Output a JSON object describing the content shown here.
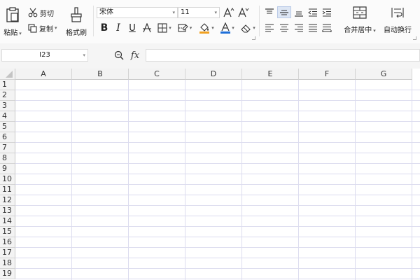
{
  "clipboard": {
    "paste": "粘贴",
    "cut": "剪切",
    "copy": "复制",
    "format_painter": "格式刷"
  },
  "font": {
    "name": "宋体",
    "size": "11"
  },
  "alignment": {
    "merge_center": "合并居中",
    "wrap_text": "自动换行"
  },
  "formula_bar": {
    "name_box": "I23",
    "fx_label": "fx",
    "value": ""
  },
  "columns": [
    "A",
    "B",
    "C",
    "D",
    "E",
    "F",
    "G"
  ],
  "rows": [
    "1",
    "2",
    "3",
    "4",
    "5",
    "6",
    "7",
    "8",
    "9",
    "10",
    "11",
    "12",
    "13",
    "14",
    "15",
    "16",
    "17",
    "18",
    "19"
  ],
  "colors": {
    "font_color": "#c00000",
    "fill_color": "#f0a020",
    "font_color_bar": "#1e6fd9",
    "active_align": "#dde6f4"
  }
}
